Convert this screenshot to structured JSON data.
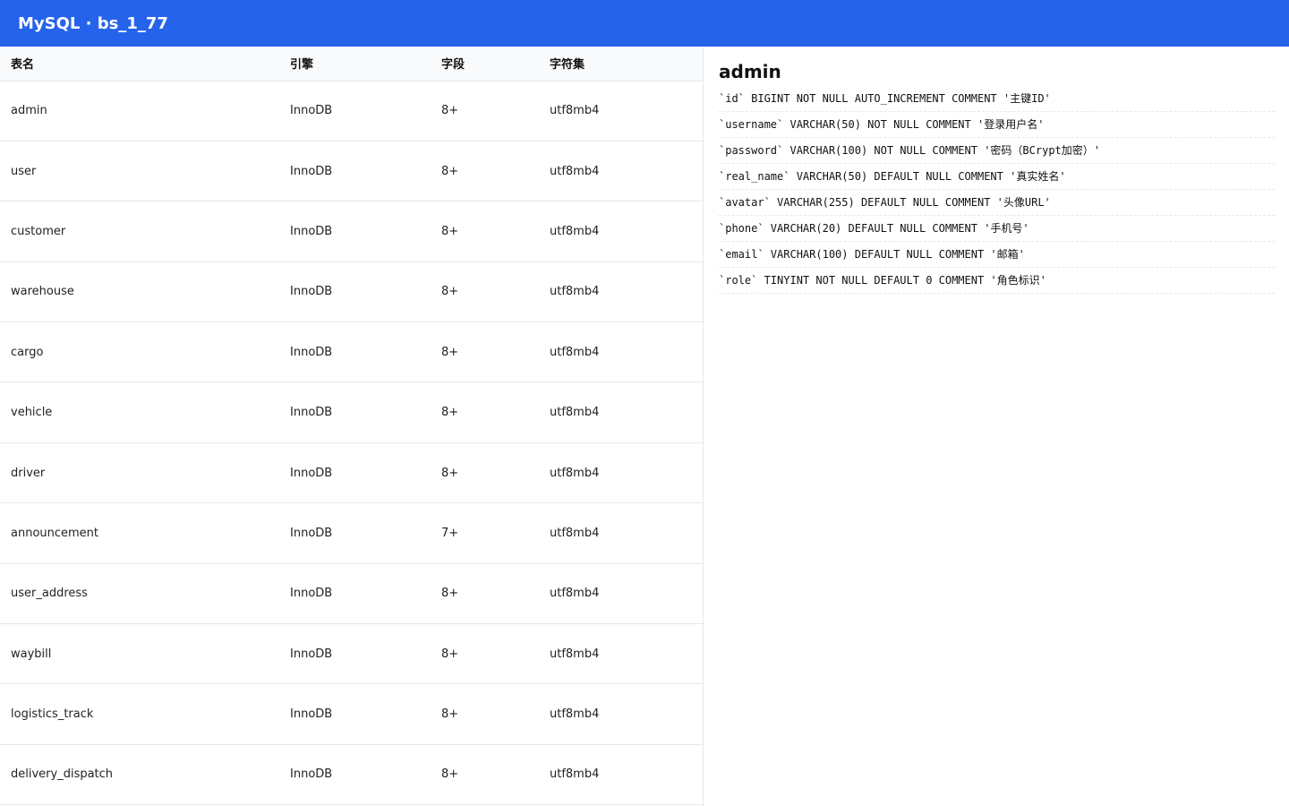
{
  "header": {
    "title": "MySQL · bs_1_77"
  },
  "table": {
    "headers": [
      "表名",
      "引擎",
      "字段",
      "字符集"
    ],
    "rows": [
      [
        "admin",
        "InnoDB",
        "8+",
        "utf8mb4"
      ],
      [
        "user",
        "InnoDB",
        "8+",
        "utf8mb4"
      ],
      [
        "customer",
        "InnoDB",
        "8+",
        "utf8mb4"
      ],
      [
        "warehouse",
        "InnoDB",
        "8+",
        "utf8mb4"
      ],
      [
        "cargo",
        "InnoDB",
        "8+",
        "utf8mb4"
      ],
      [
        "vehicle",
        "InnoDB",
        "8+",
        "utf8mb4"
      ],
      [
        "driver",
        "InnoDB",
        "8+",
        "utf8mb4"
      ],
      [
        "announcement",
        "InnoDB",
        "7+",
        "utf8mb4"
      ],
      [
        "user_address",
        "InnoDB",
        "8+",
        "utf8mb4"
      ],
      [
        "waybill",
        "InnoDB",
        "8+",
        "utf8mb4"
      ],
      [
        "logistics_track",
        "InnoDB",
        "8+",
        "utf8mb4"
      ],
      [
        "delivery_dispatch",
        "InnoDB",
        "8+",
        "utf8mb4"
      ]
    ]
  },
  "detail": {
    "title": "admin",
    "columns": [
      "`id` BIGINT NOT NULL AUTO_INCREMENT COMMENT '主键ID'",
      "`username` VARCHAR(50) NOT NULL COMMENT '登录用户名'",
      "`password` VARCHAR(100) NOT NULL COMMENT '密码（BCrypt加密）'",
      "`real_name` VARCHAR(50) DEFAULT NULL COMMENT '真实姓名'",
      "`avatar` VARCHAR(255) DEFAULT NULL COMMENT '头像URL'",
      "`phone` VARCHAR(20) DEFAULT NULL COMMENT '手机号'",
      "`email` VARCHAR(100) DEFAULT NULL COMMENT '邮箱'",
      "`role` TINYINT NOT NULL DEFAULT 0 COMMENT '角色标识'"
    ]
  },
  "colors": {
    "topbar": "#2563eb",
    "border": "#e5e7eb",
    "header_bg": "#f8fafc"
  }
}
